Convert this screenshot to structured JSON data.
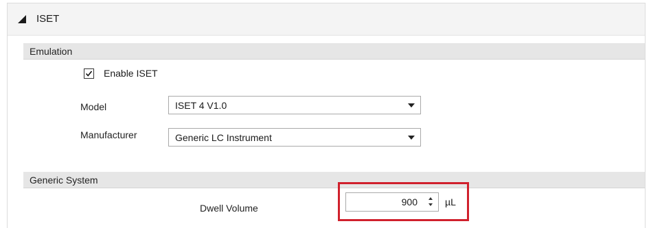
{
  "header": {
    "title": "ISET",
    "collapse_icon": "triangle-collapse-icon"
  },
  "emulation": {
    "group_label": "Emulation",
    "enable_checkbox": {
      "label": "Enable ISET",
      "checked": true
    },
    "model": {
      "label": "Model",
      "value": "ISET 4 V1.0"
    },
    "manufacturer": {
      "label": "Manufacturer",
      "value": "Generic LC Instrument"
    }
  },
  "generic_system": {
    "group_label": "Generic System",
    "dwell_volume": {
      "label": "Dwell Volume",
      "value": "900",
      "unit": "µL"
    }
  },
  "colors": {
    "highlight": "#d0202c",
    "group_bar": "#e6e6e6",
    "header_bg": "#f4f4f4"
  }
}
